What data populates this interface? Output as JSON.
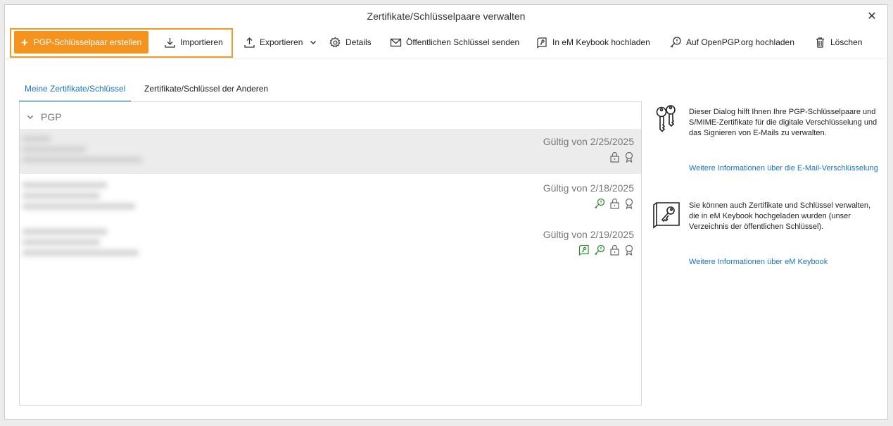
{
  "window": {
    "title": "Zertifikate/Schlüsselpaare verwalten",
    "close_glyph": "✕"
  },
  "toolbar": {
    "create_label": "PGP-Schlüsselpaar erstellen",
    "create_plus": "+",
    "import_label": "Importieren",
    "export_label": "Exportieren",
    "details_label": "Details",
    "send_public_key_label": "Öffentlichen Schlüssel senden",
    "upload_keybook_label": "In eM Keybook hochladen",
    "upload_openpgp_label": "Auf OpenPGP.org hochladen",
    "delete_label": "Löschen",
    "accent_color": "#f5931f"
  },
  "tabs": [
    {
      "label": "Meine Zertifikate/Schlüssel",
      "active": true
    },
    {
      "label": "Zertifikate/Schlüssel der Anderen",
      "active": false
    }
  ],
  "list": {
    "group_label": "PGP",
    "rows": [
      {
        "valid_text": "Gültig von 2/25/2025",
        "selected": true,
        "icons": [
          "lock-icon",
          "certificate-icon"
        ]
      },
      {
        "valid_text": "Gültig von 2/18/2025",
        "selected": false,
        "icons": [
          "key-search-icon",
          "lock-icon",
          "certificate-icon"
        ]
      },
      {
        "valid_text": "Gültig von 2/19/2025",
        "selected": false,
        "icons": [
          "keybook-icon",
          "key-search-icon",
          "lock-icon",
          "certificate-icon"
        ]
      }
    ]
  },
  "info": {
    "block1_text": "Dieser Dialog hilft Ihnen Ihre PGP-Schlüsselpaare und S/MIME-Zertifikate für die digitale Verschlüsselung und das Signieren von E-Mails zu verwalten.",
    "block1_link": "Weitere Informationen über die E-Mail-Verschlüsselung",
    "block2_text": "Sie können auch Zertifikate und Schlüssel verwalten, die in eM Keybook hochgeladen wurden (unser Verzeichnis der öffentlichen Schlüssel).",
    "block2_link": "Weitere Informationen über eM Keybook",
    "link_color": "#1a73c8"
  }
}
